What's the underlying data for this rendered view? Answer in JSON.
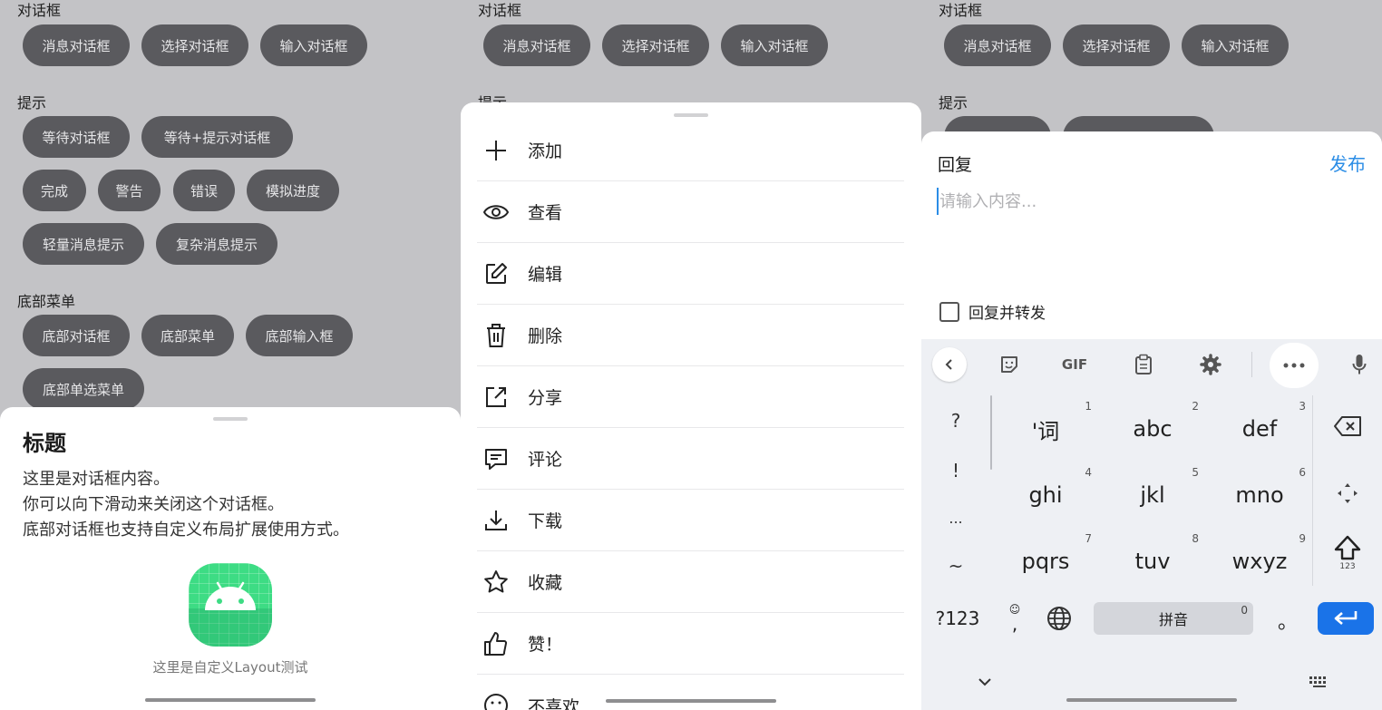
{
  "panel1": {
    "sections": [
      {
        "title": "对话框",
        "buttons": [
          "消息对话框",
          "选择对话框",
          "输入对话框"
        ]
      },
      {
        "title": "提示",
        "buttons": [
          "等待对话框",
          "等待+提示对话框",
          "完成",
          "警告",
          "错误",
          "模拟进度",
          "轻量消息提示",
          "复杂消息提示"
        ]
      },
      {
        "title": "底部菜单",
        "buttons": [
          "底部对话框",
          "底部菜单",
          "底部输入框",
          "底部单选菜单"
        ]
      }
    ],
    "bottom_dialog": {
      "title": "标题",
      "lines": [
        "这里是对话框内容。",
        "你可以向下滑动来关闭这个对话框。",
        "底部对话框也支持自定义布局扩展使用方式。"
      ],
      "caption": "这里是自定义Layout测试",
      "logo_icon": "android-icon"
    }
  },
  "panel2": {
    "bg_sections": [
      {
        "title": "对话框",
        "buttons": [
          "消息对话框",
          "选择对话框",
          "输入对话框"
        ]
      },
      {
        "title": "提示"
      }
    ],
    "menu": [
      {
        "label": "添加",
        "icon": "plus-icon"
      },
      {
        "label": "查看",
        "icon": "eye-icon"
      },
      {
        "label": "编辑",
        "icon": "edit-icon"
      },
      {
        "label": "删除",
        "icon": "trash-icon"
      },
      {
        "label": "分享",
        "icon": "share-icon"
      },
      {
        "label": "评论",
        "icon": "comment-icon"
      },
      {
        "label": "下载",
        "icon": "download-icon"
      },
      {
        "label": "收藏",
        "icon": "star-icon"
      },
      {
        "label": "赞！",
        "icon": "thumbs-up-icon"
      },
      {
        "label": "不喜欢",
        "icon": "smiley-icon"
      }
    ]
  },
  "panel3": {
    "bg_sections": [
      {
        "title": "对话框",
        "buttons": [
          "消息对话框",
          "选择对话框",
          "输入对话框"
        ]
      },
      {
        "title": "提示"
      }
    ],
    "reply": {
      "title": "回复",
      "publish": "发布",
      "placeholder": "请输入内容...",
      "checkbox_label": "回复并转发",
      "checkbox_checked": false
    },
    "keyboard": {
      "toolbar": [
        "back-icon",
        "sticker-icon",
        "GIF",
        "clipboard-icon",
        "settings-icon",
        "more-icon",
        "mic-icon"
      ],
      "left_column": [
        "?",
        "!",
        "...",
        "~"
      ],
      "keys": [
        {
          "label": "'词",
          "num": "1"
        },
        {
          "label": "abc",
          "num": "2"
        },
        {
          "label": "def",
          "num": "3"
        },
        {
          "label": "ghi",
          "num": "4"
        },
        {
          "label": "jkl",
          "num": "5"
        },
        {
          "label": "mno",
          "num": "6"
        },
        {
          "label": "pqrs",
          "num": "7"
        },
        {
          "label": "tuv",
          "num": "8"
        },
        {
          "label": "wxyz",
          "num": "9"
        }
      ],
      "shift_sub": "123",
      "bottom": {
        "symbols": "?123",
        "emoji_comma": ",",
        "space": "拼音",
        "space_num": "0",
        "period": "。"
      }
    }
  }
}
